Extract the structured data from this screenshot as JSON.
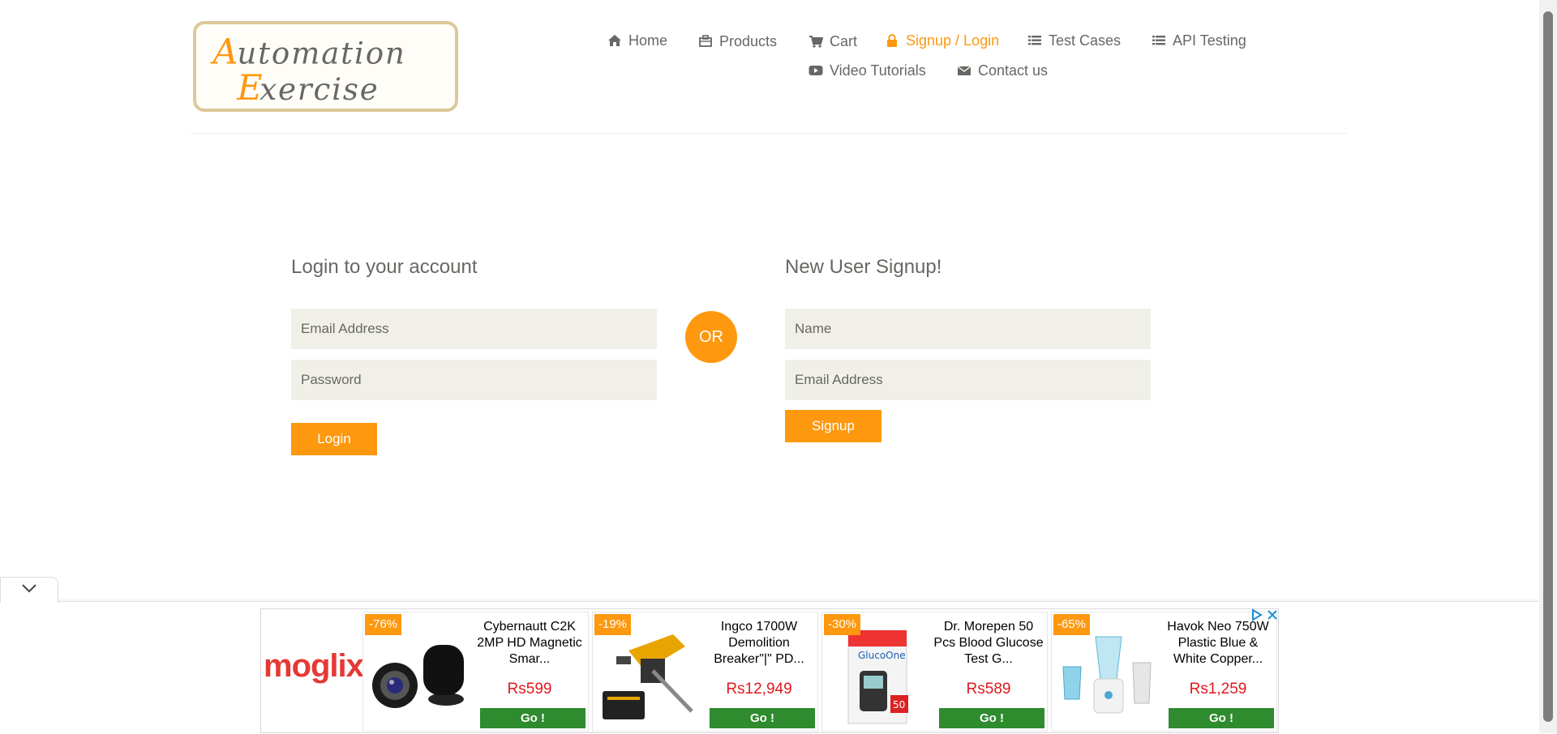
{
  "brand": {
    "logo_line1": "Automation",
    "logo_line2": "Exercise",
    "accent_color": "#FE980F",
    "logo_border_color": "#dcc89a"
  },
  "nav": {
    "items": [
      {
        "label": "Home",
        "icon": "home-icon",
        "active": false
      },
      {
        "label": "Products",
        "icon": "products-icon",
        "active": false
      },
      {
        "label": "Cart",
        "icon": "cart-icon",
        "active": false
      },
      {
        "label": "Signup / Login",
        "icon": "lock-icon",
        "active": true
      },
      {
        "label": "Test Cases",
        "icon": "list-icon",
        "active": false
      },
      {
        "label": "API Testing",
        "icon": "list-icon",
        "active": false
      },
      {
        "label": "Video Tutorials",
        "icon": "youtube-icon",
        "active": false
      },
      {
        "label": "Contact us",
        "icon": "envelope-icon",
        "active": false
      }
    ]
  },
  "login": {
    "title": "Login to your account",
    "email_placeholder": "Email Address",
    "password_placeholder": "Password",
    "button_label": "Login"
  },
  "or_label": "OR",
  "signup": {
    "title": "New User Signup!",
    "name_placeholder": "Name",
    "email_placeholder": "Email Address",
    "button_label": "Signup"
  },
  "ad": {
    "brand": "moglix",
    "go_label": "Go !",
    "cards": [
      {
        "discount": "-76%",
        "name": "Cybernautt C2K 2MP HD Magnetic Smar...",
        "price": "Rs599",
        "image": "camera-image"
      },
      {
        "discount": "-19%",
        "name": "Ingco 1700W Demolition Breaker\"|\" PD...",
        "price": "Rs12,949",
        "image": "breaker-image"
      },
      {
        "discount": "-30%",
        "name": "Dr. Morepen 50 Pcs Blood Glucose Test G...",
        "price": "Rs589",
        "image": "glucose-strips-image"
      },
      {
        "discount": "-65%",
        "name": "Havok Neo 750W Plastic Blue & White Copper...",
        "price": "Rs1,259",
        "image": "mixer-image"
      }
    ],
    "go_button_color": "#2e8b2e",
    "price_color": "#e0181e"
  }
}
